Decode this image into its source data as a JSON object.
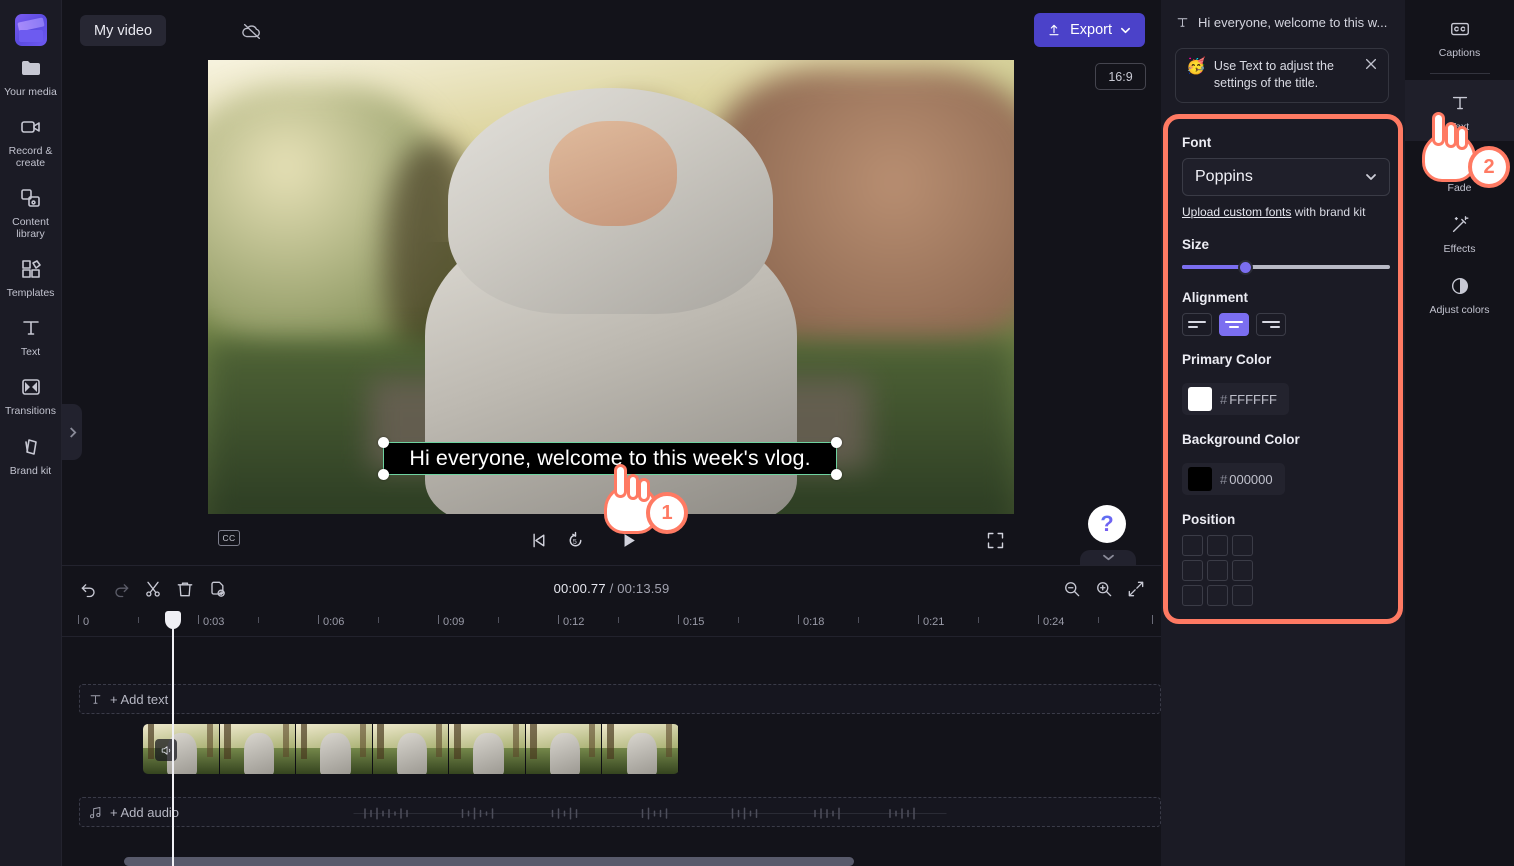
{
  "app": {
    "project_name": "My video",
    "cloud_icon": "cloud-off-icon",
    "export_label": "Export"
  },
  "left_sidebar": {
    "logo": "clipchamp-logo",
    "items": [
      {
        "label": "Your media",
        "icon": "folder-icon"
      },
      {
        "label": "Record & create",
        "icon": "video-camera-icon"
      },
      {
        "label": "Content library",
        "icon": "content-library-icon"
      },
      {
        "label": "Templates",
        "icon": "templates-icon"
      },
      {
        "label": "Text",
        "icon": "text-t-icon"
      },
      {
        "label": "Transitions",
        "icon": "transitions-icon"
      },
      {
        "label": "Brand kit",
        "icon": "brand-kit-icon"
      }
    ],
    "expand_tab_icon": "chevron-right-icon"
  },
  "preview": {
    "aspect_ratio": "16:9",
    "overlay_text": "Hi everyone, welcome to this week's vlog.",
    "controls": {
      "cc_label": "CC",
      "skip_start_icon": "skip-to-start-icon",
      "rewind_icon": "rewind-5-seconds-icon",
      "play_icon": "play-icon",
      "fullscreen_icon": "fullscreen-icon"
    },
    "help_icon": "question-mark-icon",
    "collapse_icon": "chevron-down-icon"
  },
  "timeline": {
    "tools": [
      {
        "name": "undo",
        "icon": "undo-icon"
      },
      {
        "name": "redo",
        "icon": "redo-icon"
      },
      {
        "name": "split",
        "icon": "scissors-icon"
      },
      {
        "name": "delete",
        "icon": "trash-icon"
      },
      {
        "name": "duplicate",
        "icon": "duplicate-icon"
      }
    ],
    "zoom_tools": [
      {
        "name": "zoom-out",
        "icon": "zoom-out-icon"
      },
      {
        "name": "zoom-in",
        "icon": "zoom-in-icon"
      },
      {
        "name": "fit-to-screen",
        "icon": "fit-to-screen-icon"
      }
    ],
    "current_time": "00:00.77",
    "total_time": "/ 00:13.59",
    "ruler_labels": [
      "0",
      "0:03",
      "0:06",
      "0:09",
      "0:12",
      "0:15",
      "0:18",
      "0:21",
      "0:24"
    ],
    "track_text_label": "+ Add text",
    "track_audio_label": "+ Add audio",
    "track_text_icon": "text-t-icon",
    "track_audio_icon": "music-note-icon",
    "clip_speaker_icon": "speaker-icon"
  },
  "right_panel": {
    "header_title": "Hi everyone, welcome to this w...",
    "header_icon": "text-t-icon",
    "tip": {
      "emoji": "🥳",
      "text": "Use Text to adjust the settings of the title.",
      "close_icon": "close-icon"
    },
    "font": {
      "label": "Font",
      "value": "Poppins",
      "chevron_icon": "chevron-down-icon",
      "upload_link": "Upload custom fonts",
      "upload_suffix": " with brand kit"
    },
    "size": {
      "label": "Size",
      "percent": 30
    },
    "alignment": {
      "label": "Alignment",
      "options": [
        "align-left",
        "align-center",
        "align-right"
      ],
      "selected": "align-center"
    },
    "primary_color": {
      "label": "Primary Color",
      "hex": "FFFFFF",
      "hash": "#"
    },
    "background_color": {
      "label": "Background Color",
      "hex": "000000",
      "hash": "#"
    },
    "position": {
      "label": "Position",
      "cells": 9
    },
    "highlight_color": "#ff7a63"
  },
  "right_rail": {
    "items": [
      {
        "label": "Captions",
        "icon": "closed-captions-icon",
        "active": false
      },
      {
        "label": "Text",
        "icon": "text-t-icon",
        "active": true
      },
      {
        "label": "Fade",
        "icon": "fade-icon",
        "active": false
      },
      {
        "label": "Effects",
        "icon": "magic-wand-icon",
        "active": false
      },
      {
        "label": "Adjust colors",
        "icon": "contrast-circle-icon",
        "active": false
      }
    ]
  },
  "annotations": {
    "step_one": "1",
    "step_two": "2"
  }
}
